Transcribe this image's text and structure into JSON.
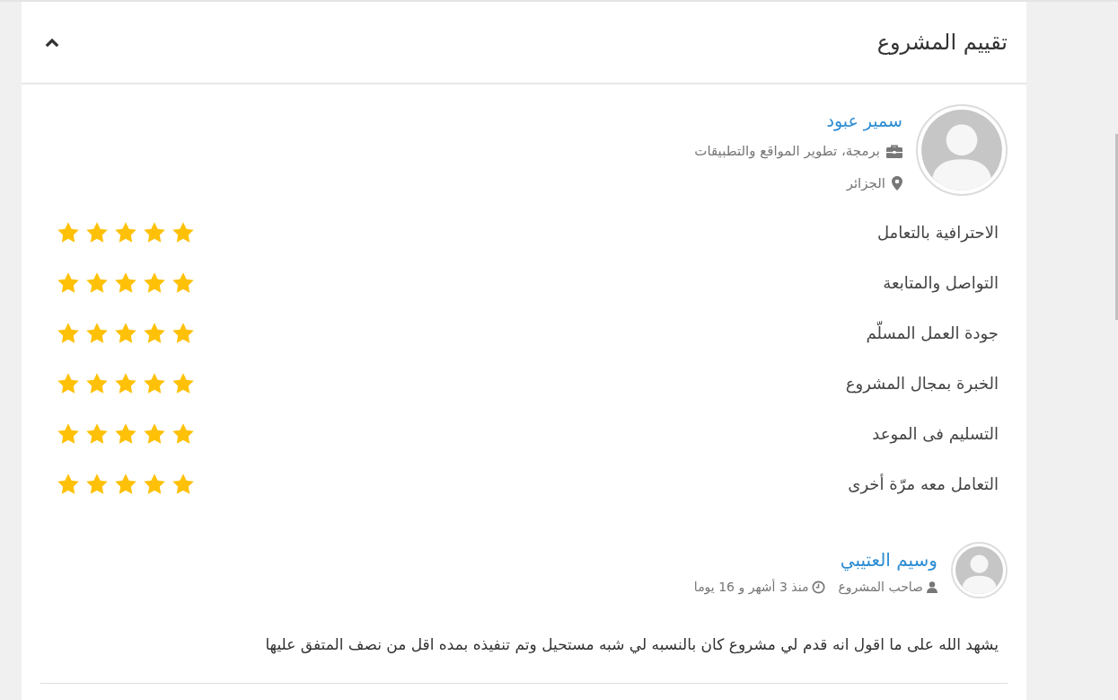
{
  "panel": {
    "title": "تقييم المشروع",
    "expanded": true
  },
  "freelancer_review": {
    "name": "سمير عبود",
    "specialty": "برمجة، تطوير المواقع والتطبيقات",
    "location": "الجزائر",
    "ratings": [
      {
        "label": "الاحترافية بالتعامل",
        "stars": 5
      },
      {
        "label": "التواصل والمتابعة",
        "stars": 5
      },
      {
        "label": "جودة العمل المسلّم",
        "stars": 5
      },
      {
        "label": "الخبرة بمجال المشروع",
        "stars": 5
      },
      {
        "label": "التسليم فى الموعد",
        "stars": 5
      },
      {
        "label": "التعامل معه مرّة أخرى",
        "stars": 5
      }
    ]
  },
  "owner_review": {
    "name": "وسيم العتيبي",
    "role": "صاحب المشروع",
    "time": "منذ 3 أشهر و 16 يوما",
    "comment": "يشهد الله على ما اقول انه قدم لي مشروع كان بالنسبه لي شبه مستحيل وتم تنفيذه بمده اقل من نصف المتفق عليها"
  }
}
